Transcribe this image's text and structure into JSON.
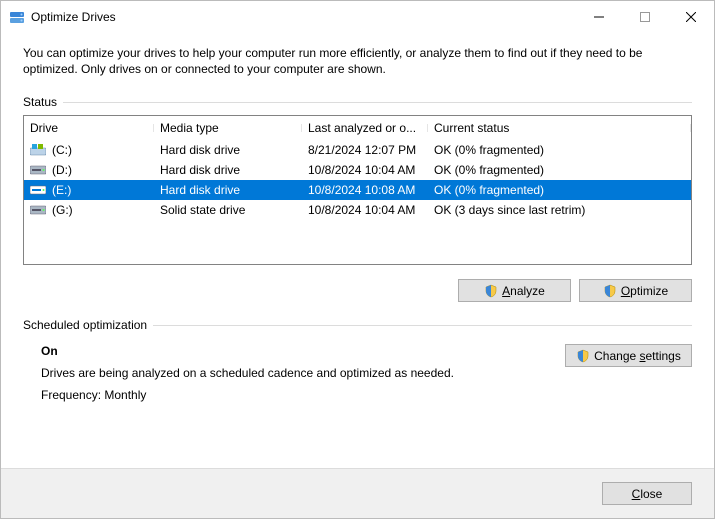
{
  "window": {
    "title": "Optimize Drives"
  },
  "intro": "You can optimize your drives to help your computer run more efficiently, or analyze them to find out if they need to be optimized. Only drives on or connected to your computer are shown.",
  "status_label": "Status",
  "columns": {
    "drive": "Drive",
    "media": "Media type",
    "date": "Last analyzed or o...",
    "status": "Current status"
  },
  "drives": [
    {
      "icon": "os",
      "name": "(C:)",
      "media": "Hard disk drive",
      "date": "8/21/2024 12:07 PM",
      "status": "OK (0% fragmented)",
      "selected": false
    },
    {
      "icon": "hdd",
      "name": "(D:)",
      "media": "Hard disk drive",
      "date": "10/8/2024 10:04 AM",
      "status": "OK (0% fragmented)",
      "selected": false
    },
    {
      "icon": "hdd",
      "name": "(E:)",
      "media": "Hard disk drive",
      "date": "10/8/2024 10:08 AM",
      "status": "OK (0% fragmented)",
      "selected": true
    },
    {
      "icon": "hdd",
      "name": "(G:)",
      "media": "Solid state drive",
      "date": "10/8/2024 10:04 AM",
      "status": "OK (3 days since last retrim)",
      "selected": false
    }
  ],
  "buttons": {
    "analyze": "Analyze",
    "optimize": "Optimize",
    "change_settings": "Change settings",
    "close": "Close"
  },
  "sched": {
    "label": "Scheduled optimization",
    "on": "On",
    "desc": "Drives are being analyzed on a scheduled cadence and optimized as needed.",
    "freq": "Frequency: Monthly"
  }
}
